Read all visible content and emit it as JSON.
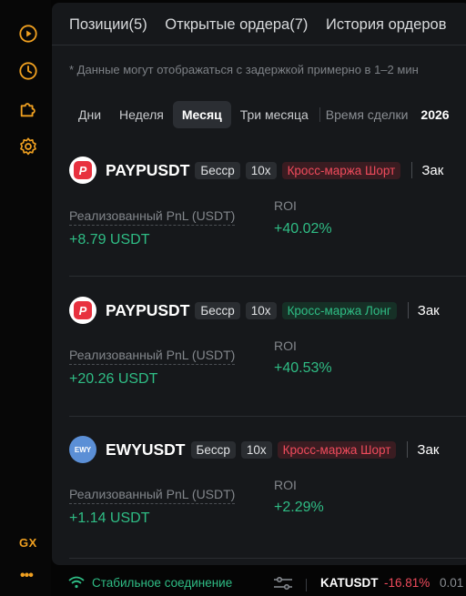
{
  "sidebar": {
    "icons": [
      "play-circle-icon",
      "clock-icon",
      "puzzle-icon",
      "gear-icon"
    ],
    "gx_label": "GX",
    "more_label": "•••"
  },
  "tabs": [
    {
      "label": "Позиции(5)"
    },
    {
      "label": "Открытые ордера(7)"
    },
    {
      "label": "История ордеров"
    }
  ],
  "notice": "* Данные могут отображаться с задержкой примерно в 1–2 мин",
  "periods": [
    {
      "label": "Дни",
      "active": false
    },
    {
      "label": "Неделя",
      "active": false
    },
    {
      "label": "Месяц",
      "active": true
    },
    {
      "label": "Три месяца",
      "active": false
    }
  ],
  "deal_time_label": "Время сделки",
  "date_value": "2026",
  "positions": [
    {
      "symbol": "PAYPUSDT",
      "coin_icon": "paypal-icon",
      "tags": [
        "Бесср",
        "10x"
      ],
      "margin": "Кросс-маржа Шорт",
      "side": "short",
      "close_label": "Зак",
      "pnl_label": "Реализованный PnL (USDT)",
      "pnl_value": "+8.79 USDT",
      "roi_label": "ROI",
      "roi_value": "+40.02%"
    },
    {
      "symbol": "PAYPUSDT",
      "coin_icon": "paypal-icon",
      "tags": [
        "Бесср",
        "10x"
      ],
      "margin": "Кросс-маржа Лонг",
      "side": "long",
      "close_label": "Зак",
      "pnl_label": "Реализованный PnL (USDT)",
      "pnl_value": "+20.26 USDT",
      "roi_label": "ROI",
      "roi_value": "+40.53%"
    },
    {
      "symbol": "EWYUSDT",
      "coin_icon": "ewy-icon",
      "coin_text": "EWY",
      "tags": [
        "Бесср",
        "10x"
      ],
      "margin": "Кросс-маржа Шорт",
      "side": "short",
      "close_label": "Зак",
      "pnl_label": "Реализованный PnL (USDT)",
      "pnl_value": "+1.14 USDT",
      "roi_label": "ROI",
      "roi_value": "+2.29%"
    }
  ],
  "status": {
    "connection": "Стабильное соединение",
    "ticker_symbol": "KATUSDT",
    "ticker_change": "-16.81%",
    "ticker_price": "0.01"
  },
  "colors": {
    "accent": "#f0a020",
    "positive": "#2fbd85",
    "negative": "#ef4b5c",
    "panel": "#16181b"
  }
}
